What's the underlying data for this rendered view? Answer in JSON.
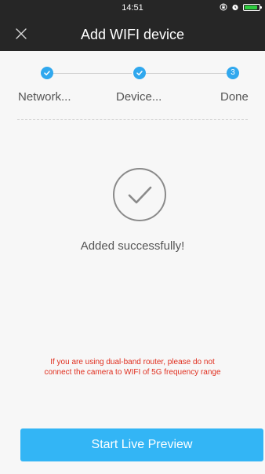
{
  "status_bar": {
    "time": "14:51"
  },
  "header": {
    "title": "Add WIFI device"
  },
  "stepper": {
    "steps": [
      {
        "label": "Network...",
        "state": "complete"
      },
      {
        "label": "Device...",
        "state": "complete"
      },
      {
        "label": "Done",
        "state": "current",
        "number": "3"
      }
    ]
  },
  "result": {
    "message": "Added successfully!"
  },
  "warning": {
    "line1": "If you are using dual-band router, please do not",
    "line2": "connect the camera to WIFI of 5G frequency range"
  },
  "actions": {
    "primary_label": "Start Live Preview"
  },
  "colors": {
    "header_bg": "#262626",
    "accent": "#30a8ee",
    "button": "#33b5f5",
    "warning": "#e02e1e",
    "background": "#f7f7f7"
  }
}
